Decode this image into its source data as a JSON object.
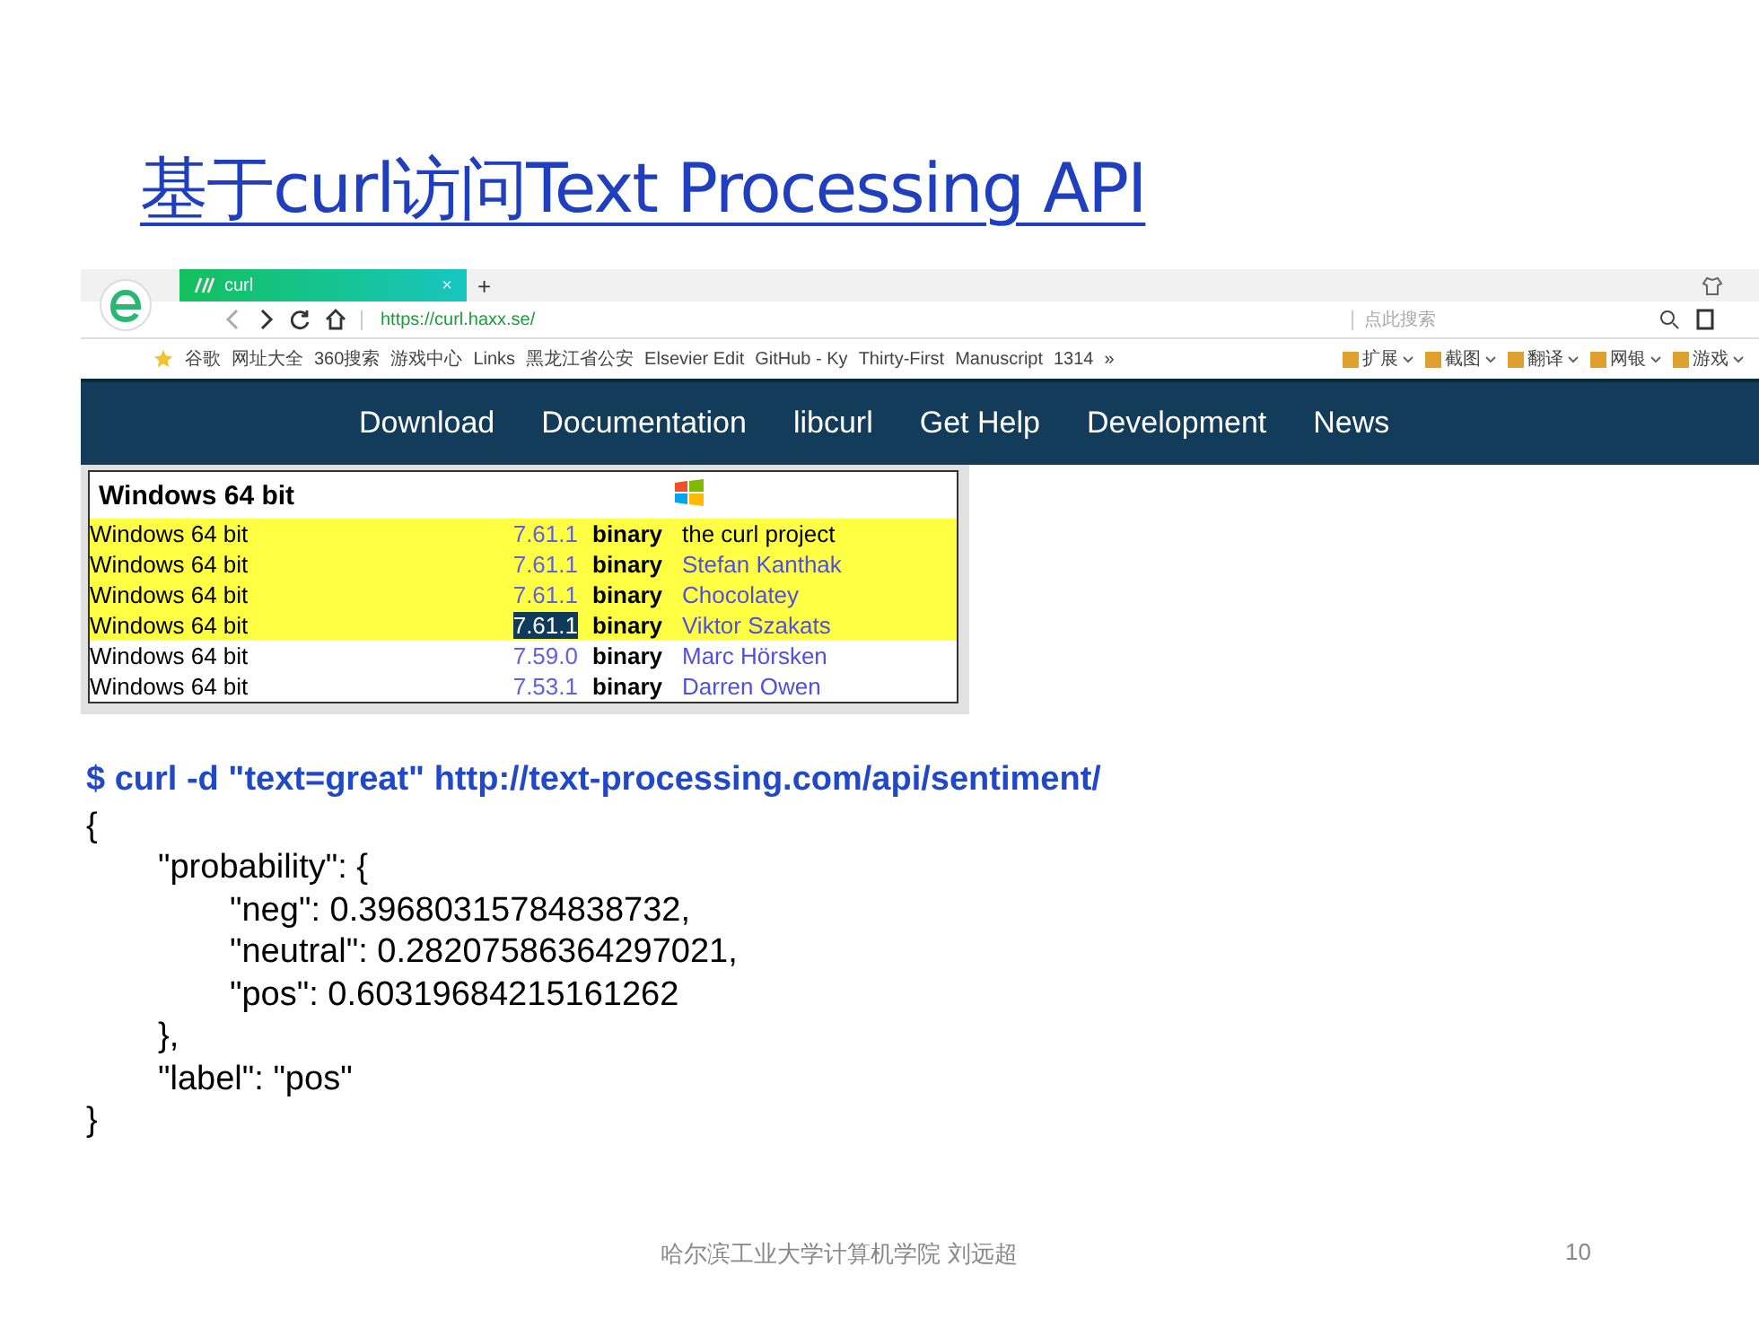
{
  "slide": {
    "title": "基于curl访问Text Processing API"
  },
  "browser": {
    "tab": {
      "title": "curl",
      "close": "×",
      "new_tab": "+"
    },
    "address": "https://curl.haxx.se/",
    "search_placeholder": "点此搜索",
    "bookmarks": [
      "谷歌",
      "网址大全",
      "360搜索",
      "游戏中心",
      "Links",
      "黑龙江省公安",
      "Elsevier Edit",
      "GitHub - Ky",
      "Thirty-First",
      "Manuscript",
      "1314",
      "»"
    ],
    "tools": [
      "扩展",
      "截图",
      "翻译",
      "网银",
      "游戏"
    ],
    "nav": [
      "Download",
      "Documentation",
      "libcurl",
      "Get Help",
      "Development",
      "News"
    ],
    "downloads": {
      "heading": "Windows 64 bit",
      "rows": [
        {
          "platform": "Windows 64 bit",
          "version": "7.61.1",
          "type": "binary",
          "provider": "the curl project",
          "highlighted": true,
          "selected": false,
          "linked": false
        },
        {
          "platform": "Windows 64 bit",
          "version": "7.61.1",
          "type": "binary",
          "provider": "Stefan Kanthak",
          "highlighted": true,
          "selected": false,
          "linked": true
        },
        {
          "platform": "Windows 64 bit",
          "version": "7.61.1",
          "type": "binary",
          "provider": "Chocolatey",
          "highlighted": true,
          "selected": false,
          "linked": true
        },
        {
          "platform": "Windows 64 bit",
          "version": "7.61.1",
          "type": "binary",
          "provider": "Viktor Szakats",
          "highlighted": true,
          "selected": true,
          "linked": true
        },
        {
          "platform": "Windows 64 bit",
          "version": "7.59.0",
          "type": "binary",
          "provider": "Marc Hörsken",
          "highlighted": false,
          "selected": false,
          "linked": true
        },
        {
          "platform": "Windows 64 bit",
          "version": "7.53.1",
          "type": "binary",
          "provider": "Darren Owen",
          "highlighted": false,
          "selected": false,
          "linked": true
        }
      ]
    }
  },
  "code": {
    "command": "$ curl -d \"text=great\" http://text-processing.com/api/sentiment/",
    "lines": [
      {
        "text": "{",
        "children": [
          {
            "text": "\"probability\": {",
            "children": [
              {
                "text": "\"neg\": 0.39680315784838732,"
              },
              {
                "text": "\"neutral\": 0.28207586364297021,"
              },
              {
                "text": "\"pos\": 0.60319684215161262"
              }
            ]
          },
          {
            "text": "},"
          },
          {
            "text": "\"label\": \"pos\""
          }
        ]
      },
      {
        "text": "}"
      }
    ]
  },
  "footer": {
    "author": "哈尔滨工业大学计算机学院 刘远超",
    "page": "10"
  }
}
